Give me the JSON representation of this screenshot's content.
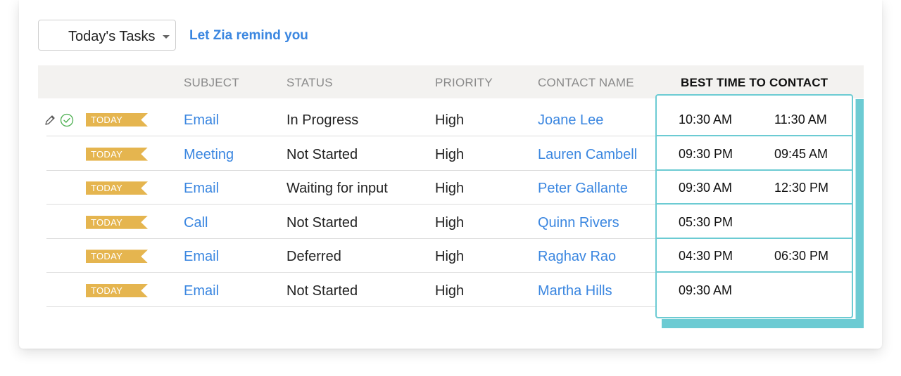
{
  "toolbar": {
    "view_selector": "Today's Tasks",
    "zia_link": "Let Zia remind you"
  },
  "table": {
    "columns": {
      "subject": "SUBJECT",
      "status": "STATUS",
      "priority": "PRIORITY",
      "contact_name": "CONTACT NAME",
      "best_time": "BEST TIME TO CONTACT"
    },
    "badge_label": "TODAY",
    "rows": [
      {
        "subject": "Email",
        "status": "In Progress",
        "priority": "High",
        "contact": "Joane Lee",
        "time_start": "10:30 AM",
        "time_end": "11:30 AM"
      },
      {
        "subject": "Meeting",
        "status": "Not Started",
        "priority": "High",
        "contact": "Lauren Cambell",
        "time_start": "09:30 PM",
        "time_end": "09:45 AM"
      },
      {
        "subject": "Email",
        "status": "Waiting for input",
        "priority": "High",
        "contact": "Peter Gallante",
        "time_start": "09:30 AM",
        "time_end": "12:30 PM"
      },
      {
        "subject": "Call",
        "status": "Not Started",
        "priority": "High",
        "contact": "Quinn Rivers",
        "time_start": "05:30 PM",
        "time_end": ""
      },
      {
        "subject": "Email",
        "status": "Deferred",
        "priority": "High",
        "contact": "Raghav Rao",
        "time_start": "04:30 PM",
        "time_end": "06:30 PM"
      },
      {
        "subject": "Email",
        "status": "Not Started",
        "priority": "High",
        "contact": "Martha Hills",
        "time_start": "09:30 AM",
        "time_end": ""
      }
    ]
  },
  "colors": {
    "link": "#3a86e0",
    "badge": "#e5b54f",
    "best_time_accent": "#6ccbd3",
    "check": "#4caf50"
  },
  "icons": {
    "edit": "pencil-icon",
    "complete": "check-circle-icon",
    "dropdown": "caret-down-icon"
  }
}
